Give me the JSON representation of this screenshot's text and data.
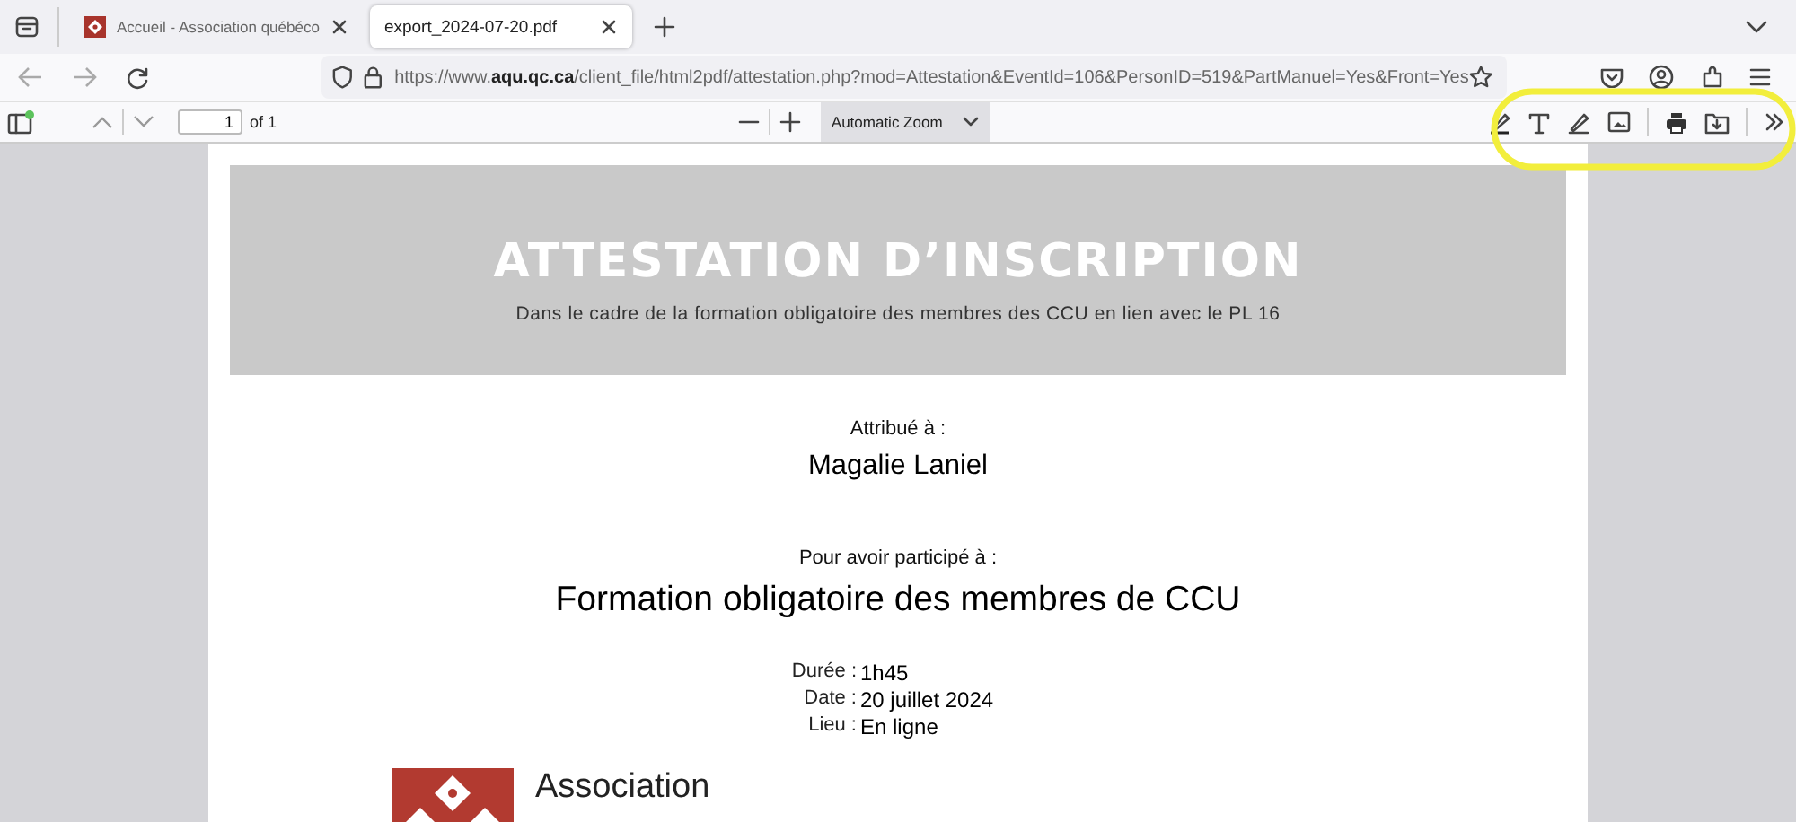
{
  "tabs": [
    {
      "label": "Accueil - Association québéco",
      "selected": false
    },
    {
      "label": "export_2024-07-20.pdf",
      "selected": true
    }
  ],
  "address_bar": {
    "url": "https://www.**aqu.qc.ca**/client_file/html2pdf/attestation.php?mod=Attestation&EventId=106&PersonID=519&PartManuel=Yes&Front=Yes"
  },
  "pdf_toolbar": {
    "page_number": "1",
    "page_count": "of 1",
    "zoom": "Automatic Zoom"
  },
  "document": {
    "title": "ATTESTATION D’INSCRIPTION",
    "subtitle": "Dans le cadre de la formation obligatoire des membres des CCU en lien avec le PL 16",
    "sections": [
      {
        "label": "Attribué à :",
        "value": "Magalie Laniel",
        "kind": "name"
      },
      {
        "label": "Pour avoir participé à :",
        "value": "Formation obligatoire des membres de CCU",
        "kind": "course"
      }
    ],
    "details": [
      {
        "label": "Durée :",
        "value": "1h45"
      },
      {
        "label": "Date :",
        "value": "20 juillet 2024"
      },
      {
        "label": "Lieu :",
        "value": "En ligne"
      }
    ],
    "logo_text": "Association"
  }
}
